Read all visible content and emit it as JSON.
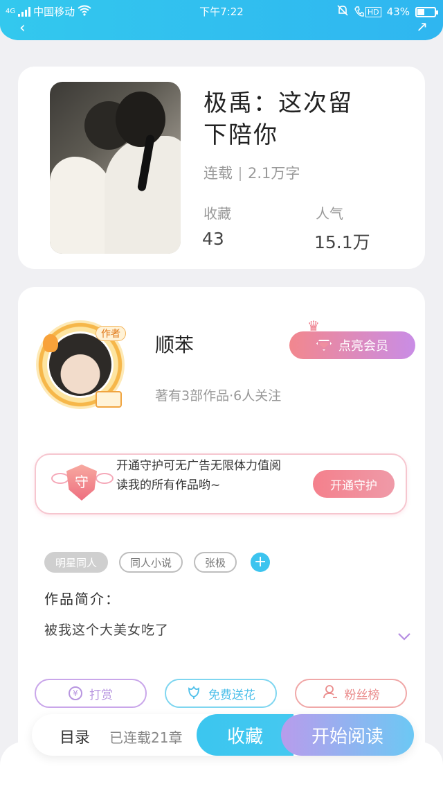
{
  "status_bar": {
    "network": "4G",
    "carrier": "中国移动",
    "time": "下午7:22",
    "hd_label": "HD",
    "battery_text": "43%",
    "battery_level": 0.43
  },
  "book": {
    "title": "极禹：这次留下陪你",
    "status": "连载",
    "word_count": "2.1万字",
    "favorites_label": "收藏",
    "favorites_value": "43",
    "popularity_label": "人气",
    "popularity_value": "15.1万"
  },
  "author": {
    "tag": "作者",
    "name": "顺苯",
    "meta": "著有3部作品·6人关注",
    "vip_button": "点亮会员"
  },
  "guard": {
    "shield_char": "守",
    "text": "开通守护可无广告无限体力值阅读我的所有作品哟~",
    "button": "开通守护"
  },
  "tags": [
    "明星同人",
    "同人小说",
    "张极"
  ],
  "tag_add": "+",
  "intro": {
    "label": "作品简介：",
    "text": "被我这个大美女吃了"
  },
  "actions": {
    "reward": "打赏",
    "reward_icon": "¥",
    "flower": "免费送花",
    "fans": "粉丝榜"
  },
  "bottom_bar": {
    "toc_label": "目录",
    "toc_count": "已连载21章",
    "collect_button": "收藏",
    "read_button": "开始阅读"
  },
  "colors": {
    "accent": "#33c8ee",
    "vip_gradient_start": "#f2878e",
    "vip_gradient_end": "#c98de6",
    "guard_pink": "#f4808c"
  }
}
